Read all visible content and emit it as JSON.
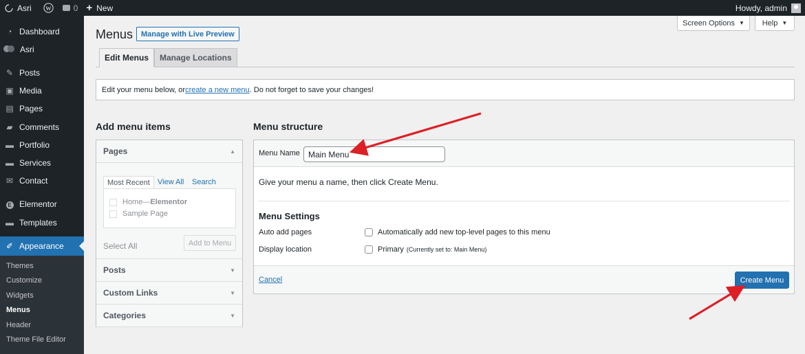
{
  "admin_bar": {
    "site_name": "Asri",
    "comments_count": "0",
    "new_label": "New",
    "greeting": "Howdy, admin"
  },
  "sidebar": {
    "items": [
      {
        "label": "Dashboard",
        "icon": "dashboard-icon"
      },
      {
        "label": "Asri",
        "icon": "asri-logo-icon"
      },
      {
        "label": "Posts",
        "icon": "pushpin-icon"
      },
      {
        "label": "Media",
        "icon": "media-icon"
      },
      {
        "label": "Pages",
        "icon": "pages-icon"
      },
      {
        "label": "Comments",
        "icon": "comment-icon"
      },
      {
        "label": "Portfolio",
        "icon": "folder-icon"
      },
      {
        "label": "Services",
        "icon": "folder-icon"
      },
      {
        "label": "Contact",
        "icon": "mail-icon"
      },
      {
        "label": "Elementor",
        "icon": "elementor-icon"
      },
      {
        "label": "Templates",
        "icon": "folder-icon"
      },
      {
        "label": "Appearance",
        "icon": "paintbrush-icon"
      }
    ],
    "submenu": [
      {
        "label": "Themes"
      },
      {
        "label": "Customize"
      },
      {
        "label": "Widgets"
      },
      {
        "label": "Menus"
      },
      {
        "label": "Header"
      },
      {
        "label": "Theme File Editor"
      }
    ]
  },
  "header": {
    "screen_options": "Screen Options",
    "help": "Help",
    "title": "Menus",
    "live_preview": "Manage with Live Preview"
  },
  "tabs": [
    {
      "label": "Edit Menus"
    },
    {
      "label": "Manage Locations"
    }
  ],
  "notice": {
    "before": "Edit your menu below, or ",
    "link": "create a new menu",
    "after": ". Do not forget to save your changes!"
  },
  "add_items": {
    "title": "Add menu items",
    "pages_heading": "Pages",
    "inner_tabs": [
      "Most Recent",
      "View All",
      "Search"
    ],
    "pages": [
      {
        "title": "Home",
        "sep": " — ",
        "suffix": "Elementor"
      },
      {
        "title": "Sample Page",
        "sep": "",
        "suffix": ""
      }
    ],
    "select_all": "Select All",
    "add_button": "Add to Menu",
    "other_sections": [
      "Posts",
      "Custom Links",
      "Categories"
    ]
  },
  "structure": {
    "title": "Menu structure",
    "name_label": "Menu Name",
    "name_value": "Main Menu",
    "hint": "Give your menu a name, then click Create Menu.",
    "settings_title": "Menu Settings",
    "auto_add_label": "Auto add pages",
    "auto_add_text": "Automatically add new top-level pages to this menu",
    "display_location_label": "Display location",
    "primary_label": "Primary",
    "primary_note": "(Currently set to: Main Menu)",
    "cancel": "Cancel",
    "create_button": "Create Menu"
  },
  "colors": {
    "accent": "#2271b1",
    "sidebar_bg": "#1d2327",
    "annotation_arrow": "#dd1f26"
  }
}
